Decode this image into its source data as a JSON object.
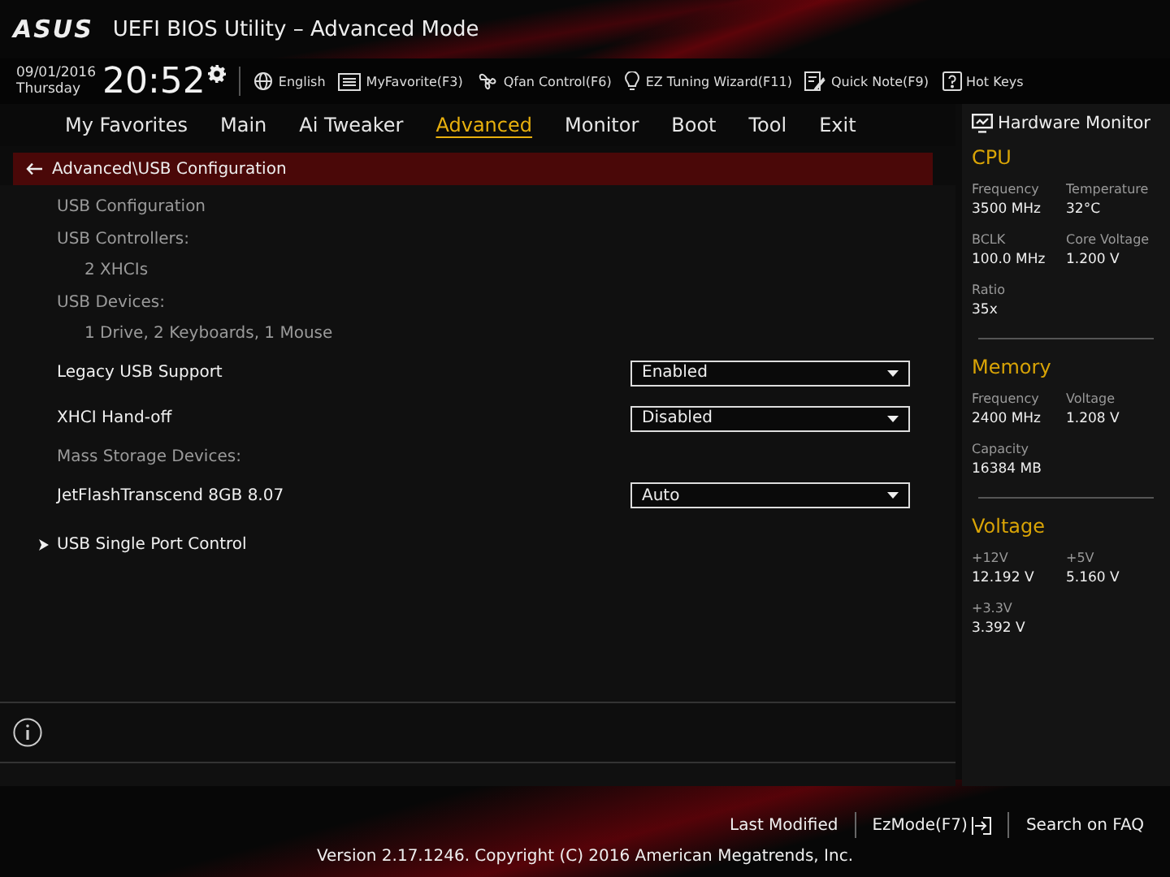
{
  "window": {
    "logo": "ASUS",
    "title": "UEFI BIOS Utility – Advanced Mode"
  },
  "clock": {
    "date": "09/01/2016",
    "day": "Thursday",
    "time": "20:52"
  },
  "toolbar": [
    {
      "kind": "globe",
      "label": "English"
    },
    {
      "kind": "favorite",
      "label": "MyFavorite(F3)"
    },
    {
      "kind": "fan",
      "label": "Qfan Control(F6)"
    },
    {
      "kind": "bulb",
      "label": "EZ Tuning Wizard(F11)"
    },
    {
      "kind": "note",
      "label": "Quick Note(F9)"
    },
    {
      "kind": "help",
      "label": "Hot Keys"
    }
  ],
  "tabs": [
    {
      "label": "My Favorites",
      "selected": false
    },
    {
      "label": "Main",
      "selected": false
    },
    {
      "label": "Ai Tweaker",
      "selected": false
    },
    {
      "label": "Advanced",
      "selected": true
    },
    {
      "label": "Monitor",
      "selected": false
    },
    {
      "label": "Boot",
      "selected": false
    },
    {
      "label": "Tool",
      "selected": false
    },
    {
      "label": "Exit",
      "selected": false
    }
  ],
  "breadcrumb": "Advanced\\USB Configuration",
  "items": [
    {
      "kind": "header",
      "label": "USB Configuration"
    },
    {
      "kind": "header",
      "label": "USB Controllers:"
    },
    {
      "kind": "info",
      "label": "2 XHCIs"
    },
    {
      "kind": "header",
      "label": "USB Devices:"
    },
    {
      "kind": "info",
      "label": "1 Drive, 2 Keyboards, 1 Mouse"
    },
    {
      "kind": "setting",
      "label": "Legacy USB Support",
      "value": "Enabled"
    },
    {
      "kind": "setting",
      "label": "XHCI Hand-off",
      "value": "Disabled"
    },
    {
      "kind": "header",
      "label": "Mass Storage Devices:"
    },
    {
      "kind": "setting",
      "label": "JetFlashTranscend 8GB 8.07",
      "value": "Auto"
    },
    {
      "kind": "submenu",
      "label": "USB Single Port Control"
    }
  ],
  "hardware_monitor": {
    "title": "Hardware Monitor",
    "sections": [
      {
        "title": "CPU",
        "fields": [
          {
            "label": "Frequency",
            "value": "3500 MHz"
          },
          {
            "label": "Temperature",
            "value": "32°C"
          },
          {
            "label": "BCLK",
            "value": "100.0 MHz"
          },
          {
            "label": "Core Voltage",
            "value": "1.200 V"
          },
          {
            "label": "Ratio",
            "value": "35x"
          }
        ]
      },
      {
        "title": "Memory",
        "fields": [
          {
            "label": "Frequency",
            "value": "2400 MHz"
          },
          {
            "label": "Voltage",
            "value": "1.208 V"
          },
          {
            "label": "Capacity",
            "value": "16384 MB"
          }
        ]
      },
      {
        "title": "Voltage",
        "fields": [
          {
            "label": "+12V",
            "value": "12.192 V"
          },
          {
            "label": "+5V",
            "value": "5.160 V"
          },
          {
            "label": "+3.3V",
            "value": "3.392 V"
          }
        ]
      }
    ]
  },
  "footer": {
    "links": [
      "Last Modified",
      "EzMode(F7)",
      "Search on FAQ"
    ],
    "version": "Version 2.17.1246. Copyright (C) 2016 American Megatrends, Inc."
  }
}
